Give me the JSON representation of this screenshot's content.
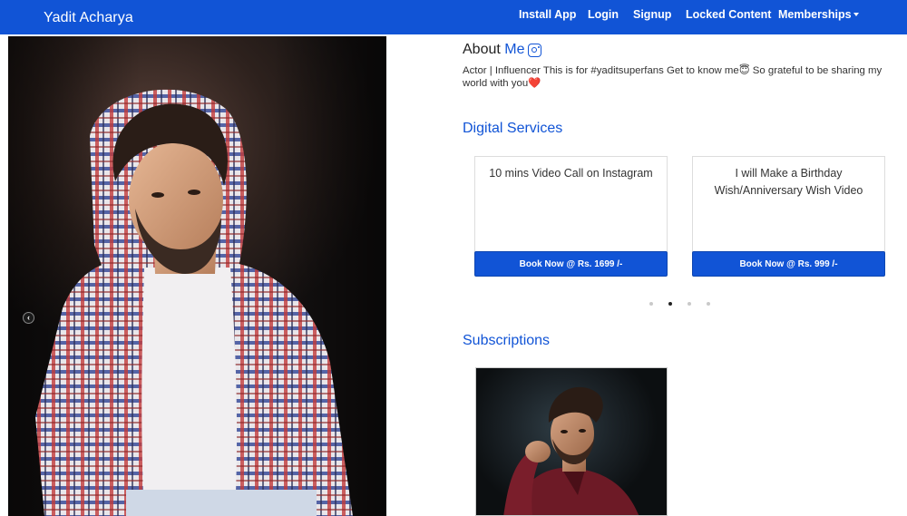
{
  "navbar": {
    "brand": "Yadit Acharya",
    "links": [
      "Install App",
      "Login",
      "Signup",
      "Locked Content",
      "Memberships"
    ]
  },
  "hero": {
    "prev_arrow_glyph": "‹"
  },
  "about": {
    "heading_prefix": "About",
    "heading_highlight": "Me",
    "bio_line1": "Actor | Influencer This is for #yaditsuperfans Get to know me😇  So grateful to be sharing my",
    "bio_line2": "world with you❤️"
  },
  "digital_services": {
    "title": "Digital Services",
    "cards": [
      {
        "text": "10 mins Video Call on Instagram",
        "button": "Book Now @ Rs. 1699 /-"
      },
      {
        "text": "I will Make a Birthday Wish/Anniversary Wish Video",
        "button": "Book Now @ Rs. 999 /-"
      }
    ],
    "carousel_dots": 4,
    "active_dot": 1
  },
  "subscriptions": {
    "title": "Subscriptions"
  },
  "colors": {
    "brand_blue": "#1154d6"
  }
}
